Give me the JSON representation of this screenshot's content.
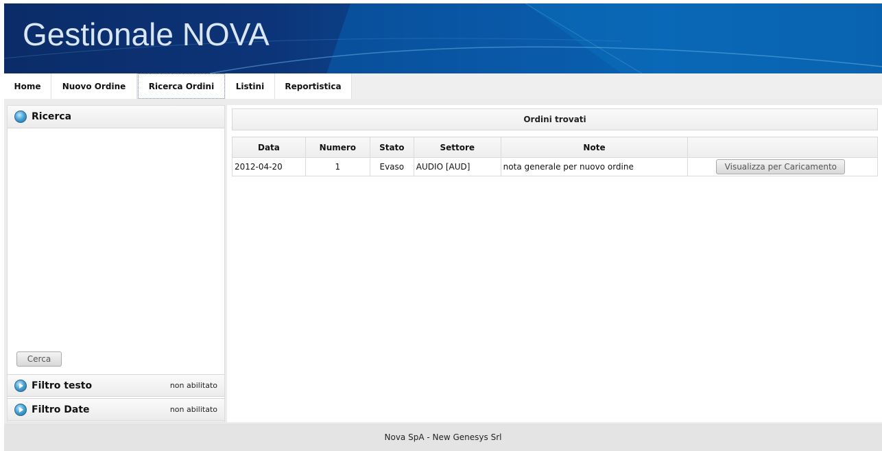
{
  "header": {
    "title": "Gestionale NOVA"
  },
  "nav": {
    "tabs": [
      {
        "label": "Home"
      },
      {
        "label": "Nuovo Ordine"
      },
      {
        "label": "Ricerca Ordini",
        "active": true
      },
      {
        "label": "Listini"
      },
      {
        "label": "Reportistica"
      }
    ]
  },
  "sidebar": {
    "search_panel": {
      "title": "Ricerca",
      "button_label": "Cerca"
    },
    "text_filter": {
      "title": "Filtro testo",
      "status": "non abilitato"
    },
    "date_filter": {
      "title": "Filtro Date",
      "status": "non abilitato"
    }
  },
  "results": {
    "title": "Ordini trovati",
    "columns": [
      "Data",
      "Numero",
      "Stato",
      "Settore",
      "Note",
      ""
    ],
    "rows": [
      {
        "data": "2012-04-20",
        "numero": "1",
        "stato": "Evaso",
        "settore": "AUDIO [AUD]",
        "note": "nota generale per nuovo ordine",
        "action_label": "Visualizza per Caricamento"
      }
    ]
  },
  "footer": {
    "text": "Nova SpA - New Genesys Srl"
  },
  "colors": {
    "header_dark": "#0b2c68",
    "header_light": "#0a63b4",
    "background": "#ececec"
  }
}
